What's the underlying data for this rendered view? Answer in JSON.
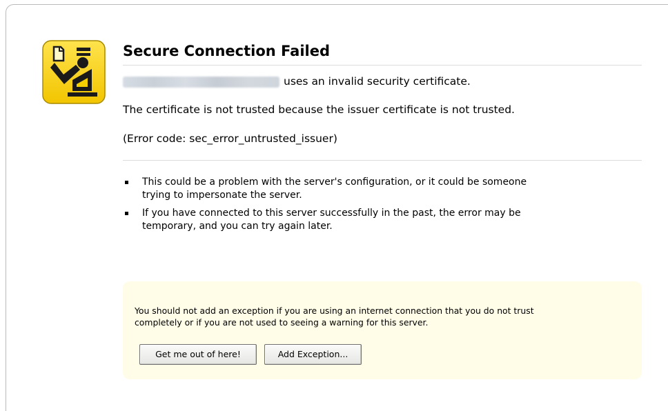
{
  "error": {
    "title": "Secure Connection Failed",
    "short_desc_suffix": "uses an invalid security certificate.",
    "detail_1": "The certificate is not trusted because the issuer certificate is not trusted.",
    "detail_2": "(Error code: sec_error_untrusted_issuer)",
    "bullets": [
      {
        "line1": "This could be a problem with the server's configuration, or it could be someone",
        "line2": "trying to impersonate the server."
      },
      {
        "line1": "If you have connected to this server successfully in the past, the error may be",
        "line2": "temporary, and you can try again later."
      }
    ]
  },
  "exception": {
    "line1": "You should not add an exception if you are using an internet connection that you do not trust",
    "line2": "completely or if you are not used to seeing a warning for this server.",
    "get_out_label": "Get me out of here!",
    "add_exception_label": "Add Exception..."
  },
  "icon": {
    "name": "security-guard-icon",
    "background_color": "#f5cf00",
    "border_color": "#a88a00"
  }
}
